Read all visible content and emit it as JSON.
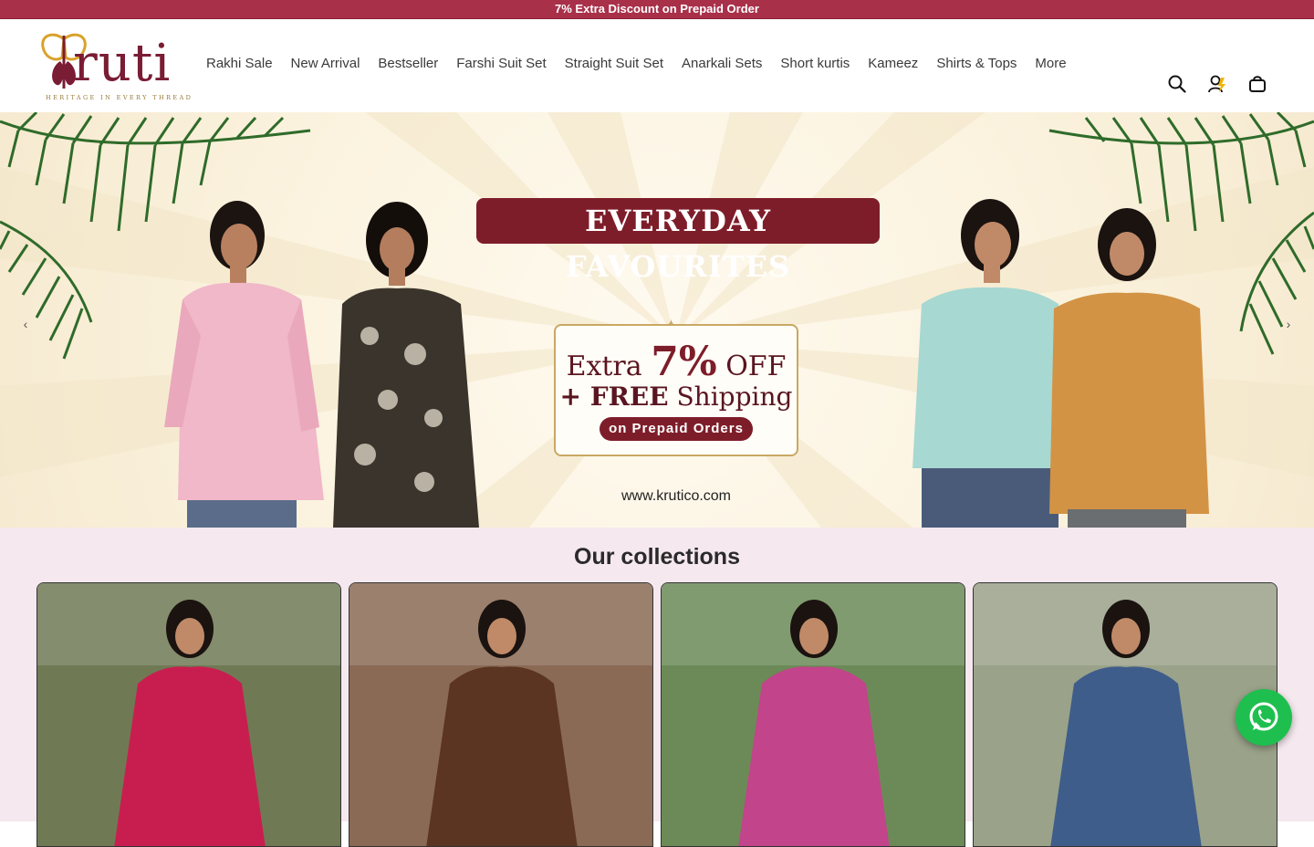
{
  "announcement": "7% Extra Discount on Prepaid Order",
  "brand": {
    "wordmark": "ruti",
    "tagline": "HERITAGE IN EVERY THREAD"
  },
  "nav": [
    "Rakhi Sale",
    "New Arrival",
    "Bestseller",
    "Farshi Suit Set",
    "Straight Suit Set",
    "Anarkali Sets",
    "Short kurtis",
    "Kameez",
    "Shirts & Tops",
    "More"
  ],
  "header_icons": [
    "search-icon",
    "account-icon",
    "cart-icon"
  ],
  "hero": {
    "title": "EVERYDAY FAVOURITES",
    "offer_extra": "Extra",
    "offer_percent": "7%",
    "offer_off": "OFF",
    "offer_free": "+ FREE",
    "offer_shipping": "Shipping",
    "offer_pill": "on Prepaid Orders",
    "website": "www.krutico.com",
    "prev": "‹",
    "next": "›"
  },
  "collections": {
    "title": "Our collections",
    "cards": [
      {
        "color": "#c81e4f",
        "bg": "#6f7a55"
      },
      {
        "color": "#5b3422",
        "bg": "#8a6a55"
      },
      {
        "color": "#c2448a",
        "bg": "#6c8a57"
      },
      {
        "color": "#3f5d8a",
        "bg": "#9aa28a"
      }
    ]
  },
  "colors": {
    "accent": "#a93049",
    "maroon": "#7e1d2a",
    "gold": "#c9a863",
    "whatsapp": "#1fbf4f"
  }
}
